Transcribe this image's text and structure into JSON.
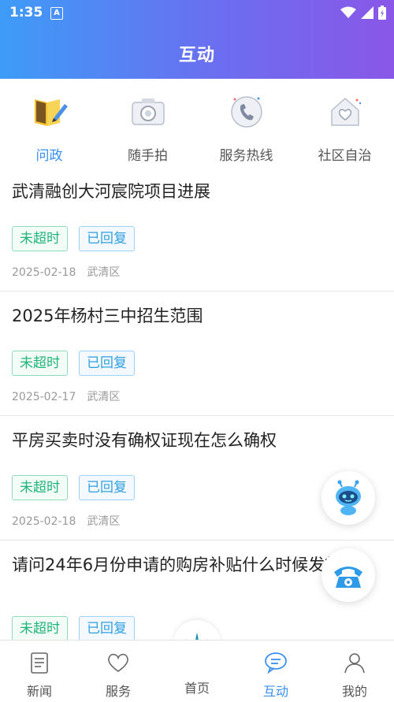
{
  "status_bar": {
    "time": "1:35",
    "badge": "A"
  },
  "header": {
    "title": "互动"
  },
  "quick_actions": [
    {
      "label": "问政",
      "icon": "book-pen-icon",
      "active": true
    },
    {
      "label": "随手拍",
      "icon": "camera-icon",
      "active": false
    },
    {
      "label": "服务热线",
      "icon": "phone-icon",
      "active": false
    },
    {
      "label": "社区自治",
      "icon": "house-heart-icon",
      "active": false
    }
  ],
  "posts": [
    {
      "question": "武清融创大河宸院项目进展",
      "tag_timeout": "未超时",
      "tag_reply": "已回复",
      "date": "2025-02-18",
      "district": "武清区"
    },
    {
      "question": "2025年杨村三中招生范围",
      "tag_timeout": "未超时",
      "tag_reply": "已回复",
      "date": "2025-02-17",
      "district": "武清区"
    },
    {
      "question": "平房买卖时没有确权证现在怎么确权",
      "tag_timeout": "未超时",
      "tag_reply": "已回复",
      "date": "2025-02-18",
      "district": "武清区"
    },
    {
      "question": "请问24年6月份申请的购房补贴什么时候发放？",
      "tag_timeout": "未超时",
      "tag_reply": "已回复"
    }
  ],
  "tabbar": {
    "news": "新闻",
    "service": "服务",
    "home": "首页",
    "interact": "互动",
    "mine": "我的"
  },
  "colors": {
    "accent": "#3a8ff0",
    "green_tag": "#1fb57a",
    "blue_tag": "#2f9fe0"
  }
}
